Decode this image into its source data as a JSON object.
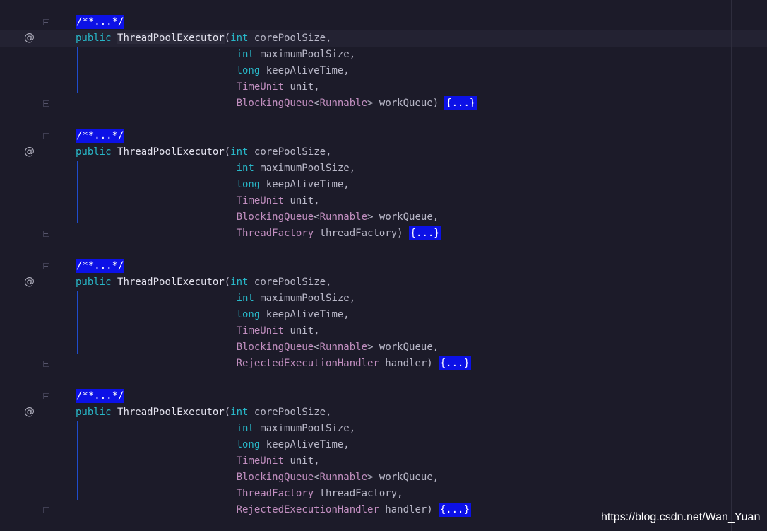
{
  "editor": {
    "doc_collapsed": "/**...*/",
    "body_collapsed": "{...}",
    "annotation_marker": "@",
    "kw_public": "public",
    "ctor_name": "ThreadPoolExecutor",
    "open_paren": "(",
    "kw_int": "int",
    "kw_long": "long",
    "p_core": " corePoolSize,",
    "p_max": " maximumPoolSize,",
    "p_keep": " keepAliveTime,",
    "t_timeunit": "TimeUnit",
    "p_unit": " unit,",
    "t_bq": "BlockingQueue",
    "lt": "<",
    "t_runnable": "Runnable",
    "gt": ">",
    "p_wq_end": " workQueue)",
    "p_wq_comma": " workQueue,",
    "t_tf": "ThreadFactory",
    "p_tf_end": " threadFactory)",
    "p_tf_comma": " threadFactory,",
    "t_reh": "RejectedExecutionHandler",
    "p_handler_end": " handler)"
  },
  "watermark": "https://blog.csdn.net/Wan_Yuan"
}
